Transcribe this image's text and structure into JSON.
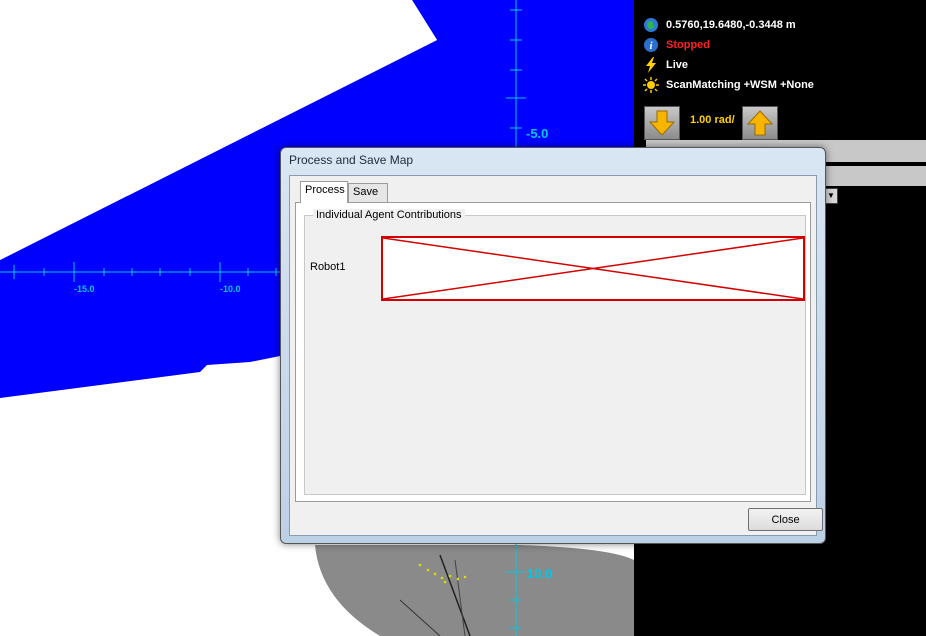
{
  "map": {
    "tick_labels_small": [
      "-15.0",
      "-10.0"
    ],
    "tick_labels_large": [
      "-5.0",
      "10.0"
    ],
    "colors": {
      "free_space": "#0000ff",
      "axis": "#00c8e6",
      "background": "#ffffff",
      "unknown": "#888888"
    }
  },
  "status": {
    "position": "0.5760,19.6480,-0.3448 m",
    "state": "Stopped",
    "connection": "Live",
    "mode": "ScanMatching +WSM +None",
    "icons": [
      "globe-icon",
      "info-icon",
      "lightning-icon",
      "sun-icon"
    ],
    "state_color": "#ff2020"
  },
  "speed": {
    "label": "1.00 rad/",
    "down_icon": "arrow-down-icon",
    "up_icon": "arrow-up-icon",
    "color": "#ffd200"
  },
  "dialog": {
    "title": "Process and Save Map",
    "tabs": [
      {
        "label": "Process",
        "active": true
      },
      {
        "label": "Save",
        "active": false
      }
    ],
    "group_label": "Individual Agent Contributions",
    "agents": [
      {
        "name": "Robot1",
        "image": "broken-image-icon"
      }
    ],
    "close_label": "Close"
  }
}
